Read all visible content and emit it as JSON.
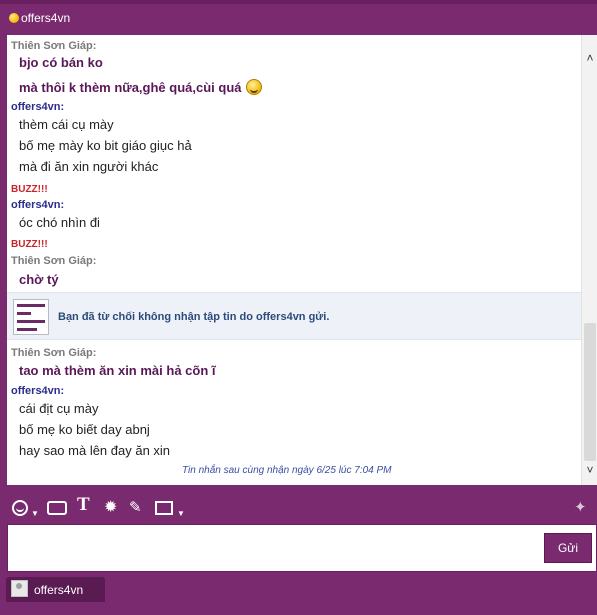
{
  "window": {
    "contact_name": "offers4vn"
  },
  "conversation": [
    {
      "type": "sender",
      "who": "them",
      "name": "Thiên Sơn Giáp:"
    },
    {
      "type": "line",
      "style": "bold",
      "text": "bjo có bán ko"
    },
    {
      "type": "line",
      "style": "bold",
      "text": "mà thôi k thèm nữa,ghê quá,cùi quá",
      "emoji": "laughing-emoji"
    },
    {
      "type": "sender",
      "who": "me",
      "name": "offers4vn:"
    },
    {
      "type": "line",
      "style": "normal",
      "text": "thèm cái cụ mày"
    },
    {
      "type": "line",
      "style": "normal",
      "text": "bố mẹ mày ko bit giáo giục hả"
    },
    {
      "type": "line",
      "style": "normal",
      "text": "mà đi ăn xin người khác"
    },
    {
      "type": "buzz",
      "text": "BUZZ!!!"
    },
    {
      "type": "sender",
      "who": "me",
      "name": "offers4vn:"
    },
    {
      "type": "line",
      "style": "normal",
      "text": "óc chó nhìn đi"
    },
    {
      "type": "buzz",
      "text": "BUZZ!!!"
    },
    {
      "type": "sender",
      "who": "them",
      "name": "Thiên Sơn Giáp:"
    },
    {
      "type": "line",
      "style": "bold",
      "text": "chờ tý"
    },
    {
      "type": "system",
      "text": "Bạn đã từ chối không nhận tập tin do offers4vn gửi."
    },
    {
      "type": "sender",
      "who": "them",
      "name": "Thiên Sơn Giáp:"
    },
    {
      "type": "line",
      "style": "bold",
      "text": "tao mà thèm ăn xin mài hả cõn ĩ"
    },
    {
      "type": "sender",
      "who": "me",
      "name": "offers4vn:"
    },
    {
      "type": "line",
      "style": "normal",
      "text": "cái địt cụ mày"
    },
    {
      "type": "line",
      "style": "normal",
      "text": "bố mẹ ko biết day abnj"
    },
    {
      "type": "line",
      "style": "normal",
      "text": "hay sao mà lên đay ăn xin"
    }
  ],
  "last_received": "Tin nhắn sau cùng nhận ngày 6/25 lúc 7:04 PM",
  "toolbar": {
    "icons": [
      "emoticon-icon",
      "wink-icon",
      "text-format-icon",
      "buzz-icon",
      "attach-icon",
      "photo-share-icon",
      "contact-icon"
    ]
  },
  "input": {
    "value": "",
    "send_label": "Gửi"
  },
  "tabs": [
    {
      "label": "offers4vn"
    }
  ],
  "colors": {
    "frame": "#7a2a6f",
    "sender_them": "#7a7a7a",
    "sender_me": "#2b2d8c",
    "buzz": "#c8242a",
    "bold_text": "#5a1758"
  }
}
